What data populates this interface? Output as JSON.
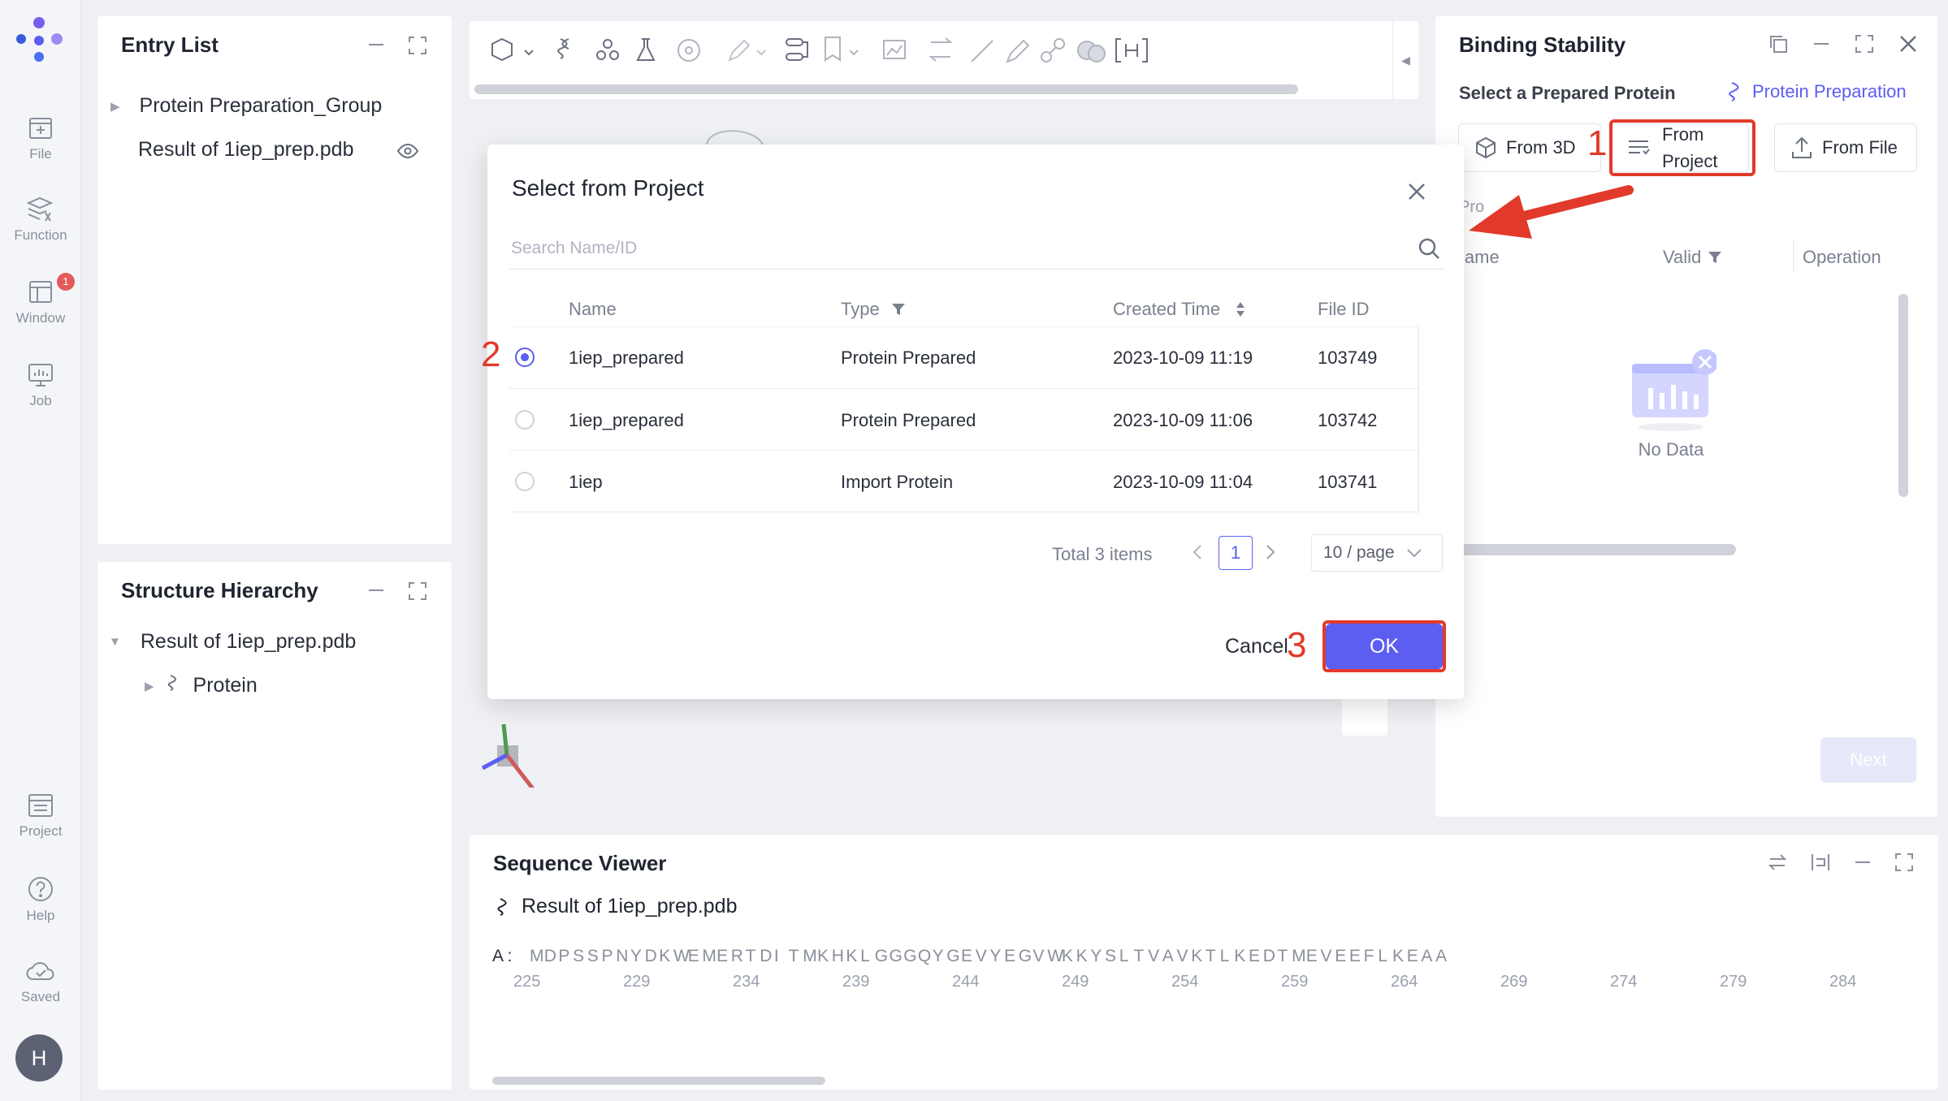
{
  "rail": {
    "items": [
      {
        "label": "File",
        "icon": "file-add-icon"
      },
      {
        "label": "Function",
        "icon": "function-icon"
      },
      {
        "label": "Window",
        "icon": "window-icon",
        "badge": "1"
      },
      {
        "label": "Job",
        "icon": "job-monitor-icon"
      },
      {
        "label": "Project",
        "icon": "project-list-icon"
      },
      {
        "label": "Help",
        "icon": "help-icon"
      },
      {
        "label": "Saved",
        "icon": "cloud-saved-icon"
      }
    ],
    "avatar": "H"
  },
  "entry_list": {
    "title": "Entry List",
    "items": [
      "Protein Preparation_Group",
      "Result of 1iep_prep.pdb"
    ]
  },
  "structure_hierarchy": {
    "title": "Structure Hierarchy",
    "root": "Result of 1iep_prep.pdb",
    "child": "Protein"
  },
  "modal": {
    "title": "Select from Project",
    "search_placeholder": "Search Name/ID",
    "columns": [
      "Name",
      "Type",
      "Created Time",
      "File ID"
    ],
    "rows": [
      {
        "name": "1iep_prepared",
        "type": "Protein Prepared",
        "created": "2023-10-09 11:19",
        "file_id": "103749",
        "selected": true
      },
      {
        "name": "1iep_prepared",
        "type": "Protein Prepared",
        "created": "2023-10-09 11:06",
        "file_id": "103742",
        "selected": false
      },
      {
        "name": "1iep",
        "type": "Import Protein",
        "created": "2023-10-09 11:04",
        "file_id": "103741",
        "selected": false
      }
    ],
    "total": "Total 3 items",
    "page": "1",
    "page_size": "10 / page",
    "cancel": "Cancel",
    "ok": "OK"
  },
  "binding": {
    "title": "Binding Stability",
    "select_label": "Select a Prepared Protein",
    "link": "Protein Preparation",
    "from_3d": "From 3D",
    "from_project_1": "From",
    "from_project_2": "Project",
    "from_file": "From File",
    "partial": "Pro",
    "col_name": "Name",
    "col_valid": "Valid",
    "col_operation": "Operation",
    "empty": "No Data",
    "next": "Next"
  },
  "annotations": {
    "step1": "1",
    "step2": "2",
    "step3": "3"
  },
  "sequence": {
    "title": "Sequence Viewer",
    "file": "Result of 1iep_prep.pdb",
    "chain": "A :",
    "letters": [
      "M",
      "D",
      "P",
      "S",
      "S",
      "P",
      "N",
      "Y",
      "D",
      "K",
      "W",
      "E",
      "M",
      "E",
      "R",
      "T",
      "D",
      "I",
      "T",
      "M",
      "K",
      "H",
      "K",
      "L",
      "G",
      "G",
      "G",
      "Q",
      "Y",
      "G",
      "E",
      "V",
      "Y",
      "E",
      "G",
      "V",
      "W",
      "K",
      "K",
      "Y",
      "S",
      "L",
      "T",
      "V",
      "A",
      "V",
      "K",
      "T",
      "L",
      "K",
      "E",
      "D",
      "T",
      "M",
      "E",
      "V",
      "E",
      "E",
      "F",
      "L",
      "K",
      "E",
      "A",
      "A"
    ],
    "numbers": [
      "225",
      "229",
      "234",
      "239",
      "244",
      "249",
      "254",
      "259",
      "264",
      "269",
      "274",
      "279",
      "284"
    ]
  },
  "colors": {
    "accent": "#5b5ef0",
    "annotation": "#e23a2a"
  }
}
